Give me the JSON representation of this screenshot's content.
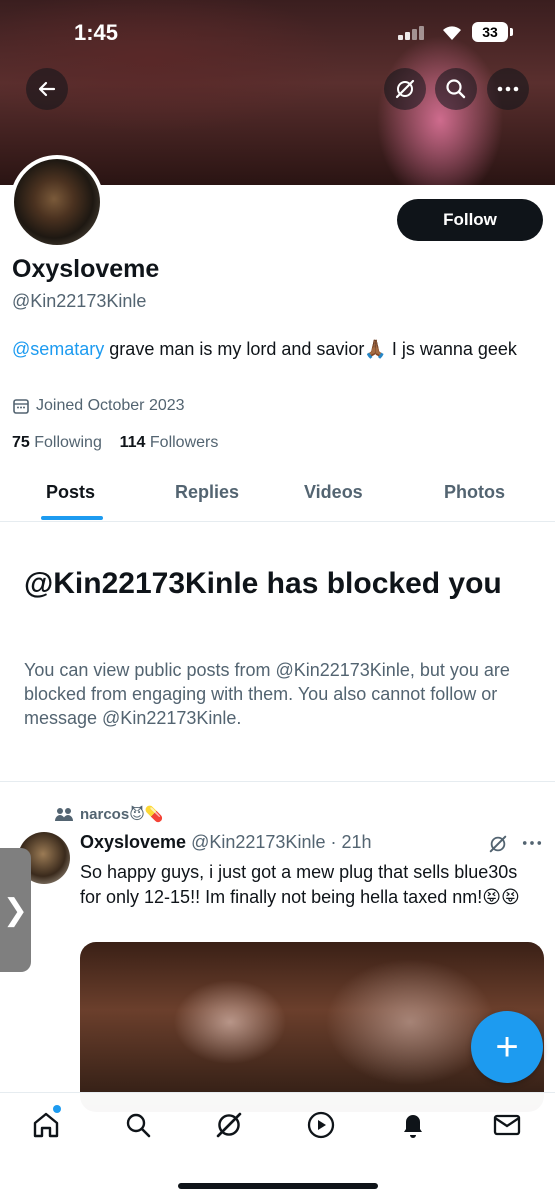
{
  "status_bar": {
    "time": "1:45",
    "battery": "33"
  },
  "header": {
    "back_icon": "back-arrow-icon",
    "grok_icon": "grok-icon",
    "search_icon": "search-icon",
    "more_icon": "more-icon"
  },
  "profile": {
    "name": "Oxysloveme",
    "handle": "@Kin22173Kinle",
    "follow_label": "Follow",
    "bio_mention": "@sematary",
    "bio_text": " grave man is my lord and savior🙏🏾 I js wanna geek",
    "joined": "Joined October 2023",
    "following_count": "75",
    "following_label": "Following",
    "followers_count": "114",
    "followers_label": "Followers"
  },
  "tabs": [
    "Posts",
    "Replies",
    "Videos",
    "Photos"
  ],
  "blocked": {
    "title": "@Kin22173Kinle has blocked you",
    "description": "You can view public posts from @Kin22173Kinle, but you are blocked from engaging with them. You also cannot follow or message @Kin22173Kinle."
  },
  "post": {
    "repost_label": "narcos😈💊",
    "author": "Oxysloveme",
    "handle_time": "@Kin22173Kinle · 21h",
    "text": "So happy guys, i just got a mew plug that sells blue30s for only 12-15!! Im finally not being hella taxed nm!😝😝"
  },
  "side_tab_glyph": "❯",
  "fab_label": "+",
  "colors": {
    "accent": "#1d9bf0",
    "text": "#0f1419",
    "secondary": "#536471"
  }
}
